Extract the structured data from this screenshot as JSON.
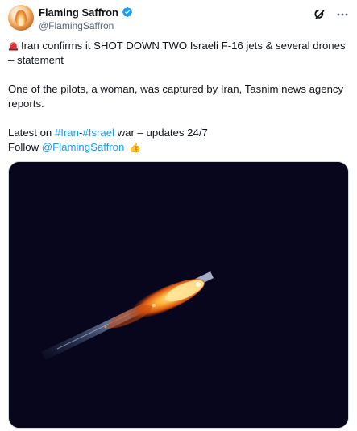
{
  "author": {
    "display_name": "Flaming Saffron",
    "handle": "@FlamingSaffron",
    "avatar_icon": "flame-avatar",
    "verified_icon": "verified-badge-icon"
  },
  "header_actions": {
    "grok_icon": "grok-icon",
    "more_icon": "more-options-icon"
  },
  "tweet": {
    "line1_emoji": "siren-emoji",
    "line1_text": "Iran confirms it SHOT DOWN TWO Israeli F-16 jets & several drones – statement",
    "line2_text": "One of the pilots, a woman, was captured by Iran, Tasnim news agency reports.",
    "line3_prefix": "Latest on ",
    "hashtag_iran": "#Iran",
    "hashtag_sep": "-",
    "hashtag_israel": "#Israel",
    "line3_suffix": " war – updates 24/7",
    "line4_prefix": "Follow ",
    "mention": "@FlamingSaffron",
    "line4_emoji": "👍"
  },
  "media": {
    "description_icon": "night-sky-burning-aircraft-image"
  },
  "colors": {
    "link": "#1d9bf0",
    "text": "#0f1419",
    "secondary": "#536471",
    "verified": "#1d9bf0",
    "media_bg": "#07061c"
  }
}
